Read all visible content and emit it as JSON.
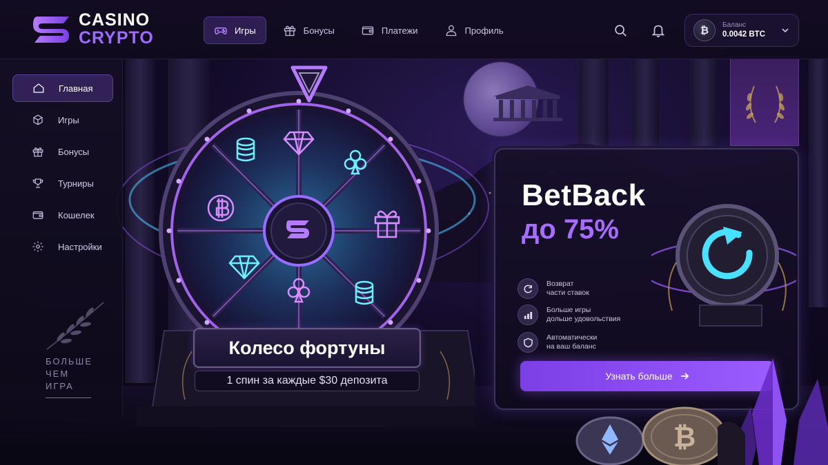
{
  "brand": {
    "line1": "CASINO",
    "line2": "CRYPTO",
    "accent": "#a06bff"
  },
  "nav": {
    "items": [
      {
        "label": "Игры",
        "icon": "gamepad-icon",
        "active": true
      },
      {
        "label": "Бонусы",
        "icon": "gift-icon"
      },
      {
        "label": "Платежи",
        "icon": "wallet-icon"
      },
      {
        "label": "Профиль",
        "icon": "user-icon"
      }
    ]
  },
  "header": {
    "search_icon": "search-icon",
    "bell_icon": "bell-icon"
  },
  "balance": {
    "label": "Баланс",
    "value": "0.0042 BTC",
    "coin_symbol": "₿"
  },
  "sidebar": {
    "items": [
      {
        "label": "Главная",
        "icon": "home-icon",
        "active": true
      },
      {
        "label": "Игры",
        "icon": "cube-icon"
      },
      {
        "label": "Бонусы",
        "icon": "gift-icon"
      },
      {
        "label": "Турниры",
        "icon": "trophy-icon"
      },
      {
        "label": "Кошелек",
        "icon": "wallet-icon"
      },
      {
        "label": "Настройки",
        "icon": "gear-icon"
      }
    ],
    "tagline": [
      "БОЛЬШЕ",
      "ЧЕМ",
      "ИГРА"
    ]
  },
  "wheel": {
    "title": "Колесо фортуны",
    "subtitle": "1 спин за каждые $30 депозита",
    "segments": [
      "diamond-icon",
      "club-icon",
      "gift-icon",
      "coins-icon",
      "club-icon",
      "diamond-icon",
      "bitcoin-icon",
      "coins-icon"
    ]
  },
  "betback": {
    "title": "BetBack",
    "subtitle": "до 75%",
    "features": [
      {
        "icon": "refresh-icon",
        "line1": "Возврат",
        "line2": "части ставок"
      },
      {
        "icon": "bars-icon",
        "line1": "Больше игры",
        "line2": "дольше удовольствия"
      },
      {
        "icon": "shield-icon",
        "line1": "Автоматически",
        "line2": "на ваш баланс"
      }
    ],
    "button": "Узнать больше",
    "accent": "#9b5cff"
  }
}
